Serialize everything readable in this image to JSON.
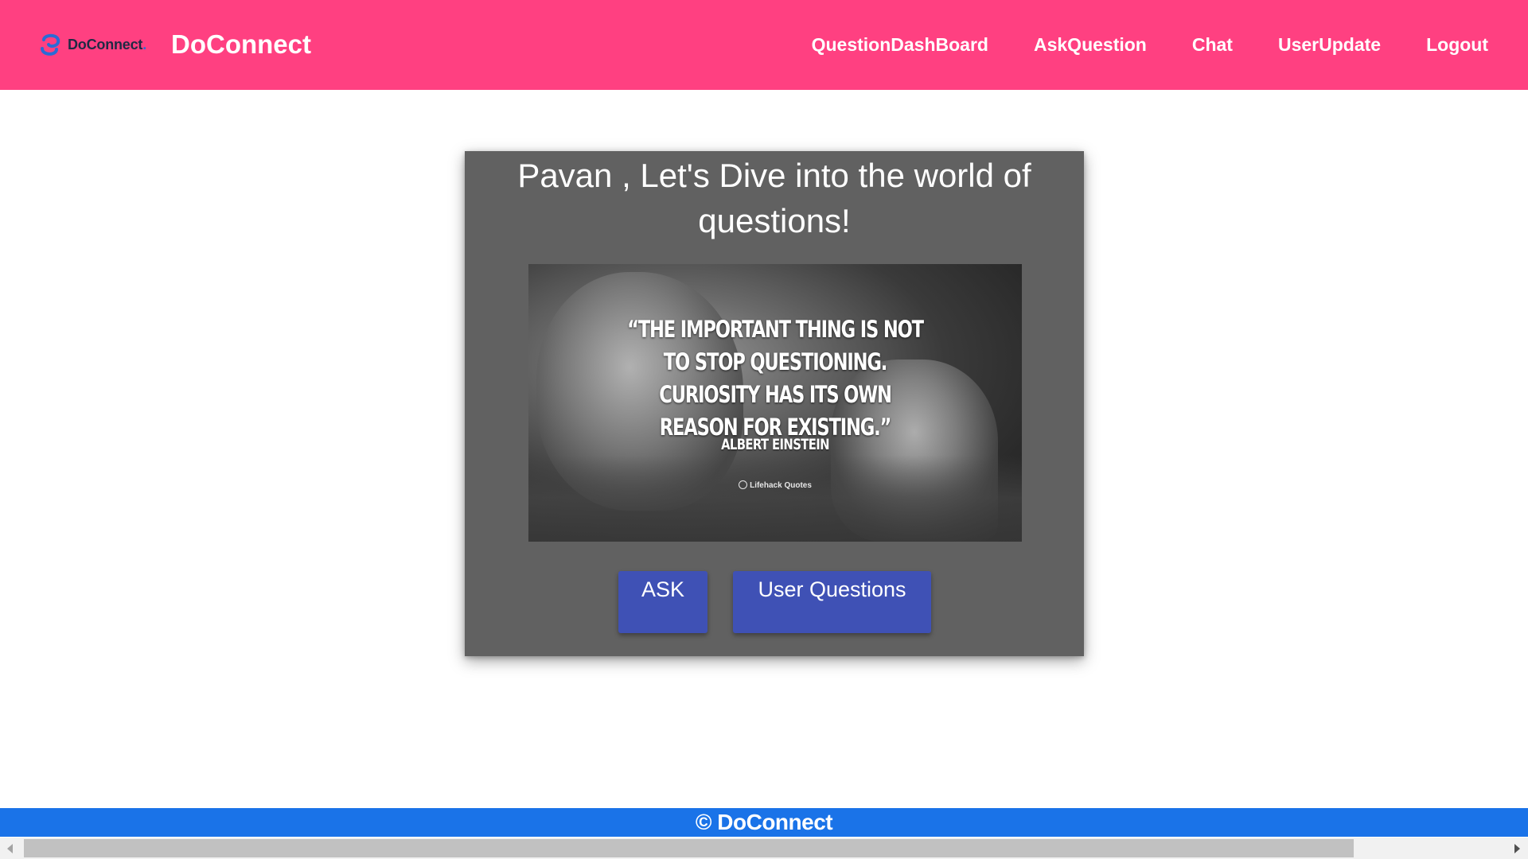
{
  "navbar": {
    "logo_text": "DoConnect",
    "logo_dot": ".",
    "brand_title": "DoConnect",
    "links": [
      {
        "label": "QuestionDashBoard"
      },
      {
        "label": "AskQuestion"
      },
      {
        "label": "Chat"
      },
      {
        "label": "UserUpdate"
      },
      {
        "label": "Logout"
      }
    ]
  },
  "card": {
    "heading": "Pavan , Let's Dive into the world of questions!",
    "image": {
      "quote": "“THE IMPORTANT THING IS NOT TO STOP QUESTIONING. CURIOSITY HAS ITS OWN REASON FOR EXISTING.”",
      "author": "ALBERT EINSTEIN",
      "source": "Lifehack Quotes"
    },
    "buttons": {
      "ask": "ASK",
      "user_questions": "User Questions"
    }
  },
  "footer": {
    "text": "© DoConnect"
  },
  "colors": {
    "navbar_bg": "#ff4081",
    "card_bg": "#616161",
    "button_bg": "#3f51b5",
    "footer_bg": "#1a73e8"
  }
}
